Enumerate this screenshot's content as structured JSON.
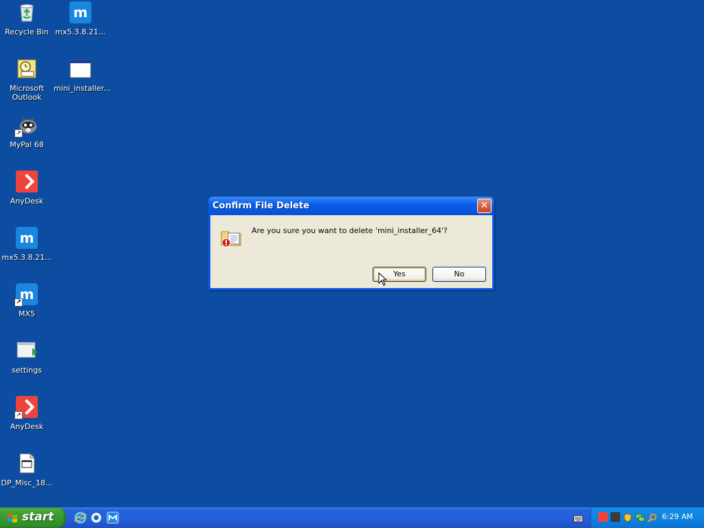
{
  "desktop": {
    "icons": [
      {
        "label": "Recycle Bin",
        "type": "recycle-bin"
      },
      {
        "label": "mx5.3.8.21...",
        "type": "maxthon"
      },
      {
        "label": "Microsoft Outlook",
        "type": "outlook"
      },
      {
        "label": "mini_installer...",
        "type": "window"
      },
      {
        "label": "MyPal 68",
        "type": "mypal"
      },
      {
        "label": "AnyDesk",
        "type": "anydesk"
      },
      {
        "label": "mx5.3.8.21...",
        "type": "maxthon"
      },
      {
        "label": "MX5",
        "type": "maxthon"
      },
      {
        "label": "settings",
        "type": "folder"
      },
      {
        "label": "AnyDesk",
        "type": "anydesk"
      },
      {
        "label": "DP_Misc_18...",
        "type": "document"
      }
    ]
  },
  "dialog": {
    "title": "Confirm File Delete",
    "close_glyph": "✕",
    "message": "Are you sure you want to delete 'mini_installer_64'?",
    "yes_label": "Yes",
    "no_label": "No"
  },
  "taskbar": {
    "start_label": "start",
    "quick_launch": [
      "ie-icon",
      "mypal-icon",
      "maxthon-icon"
    ],
    "clock": "6:29 AM"
  },
  "colors": {
    "desktop_bg": "#0c4da1",
    "titlebar": "#0a58e8",
    "dialog_body": "#ece9d8",
    "start_green": "#3c9e33"
  }
}
